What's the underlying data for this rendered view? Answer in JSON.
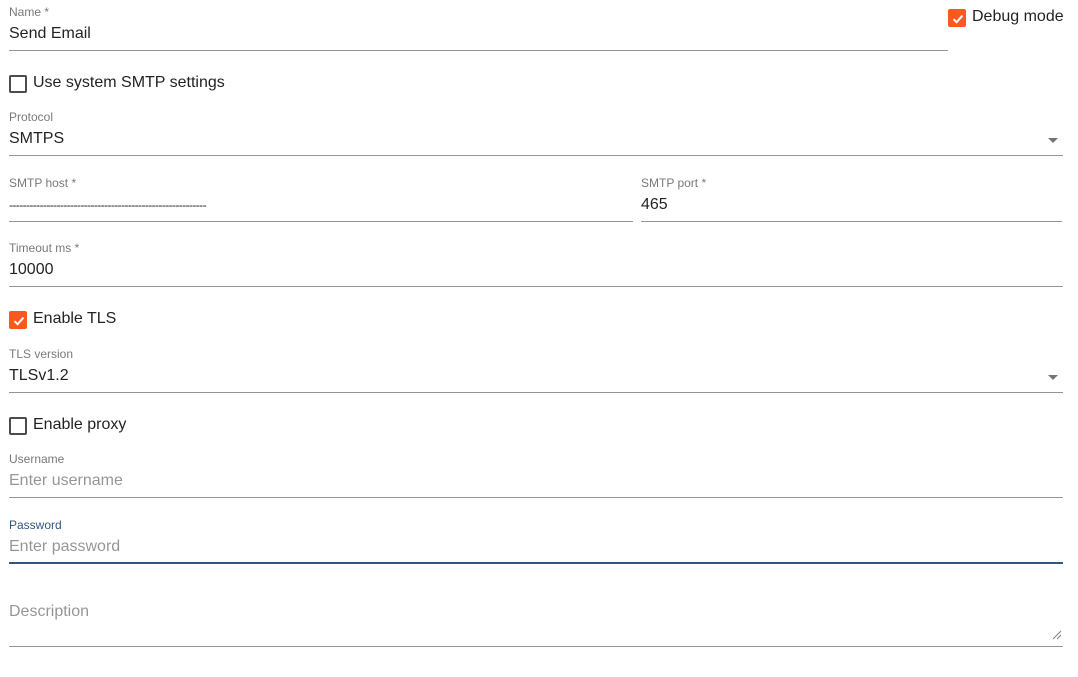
{
  "name_field": {
    "label": "Name *",
    "value": "Send Email"
  },
  "debug_mode": {
    "label": "Debug mode",
    "checked": true
  },
  "use_system_smtp": {
    "label": "Use system SMTP settings",
    "checked": false
  },
  "protocol": {
    "label": "Protocol",
    "value": "SMTPS"
  },
  "smtp_host": {
    "label": "SMTP host *",
    "value": "----------------------------------------------------------"
  },
  "smtp_port": {
    "label": "SMTP port *",
    "value": "465"
  },
  "timeout": {
    "label": "Timeout ms *",
    "value": "10000"
  },
  "enable_tls": {
    "label": "Enable TLS",
    "checked": true
  },
  "tls_version": {
    "label": "TLS version",
    "value": "TLSv1.2"
  },
  "enable_proxy": {
    "label": "Enable proxy",
    "checked": false
  },
  "username": {
    "label": "Username",
    "placeholder": "Enter username"
  },
  "password": {
    "label": "Password",
    "placeholder": "Enter password"
  },
  "description": {
    "placeholder": "Description"
  },
  "colors": {
    "accent": "#ff5722",
    "focus": "#305680"
  }
}
